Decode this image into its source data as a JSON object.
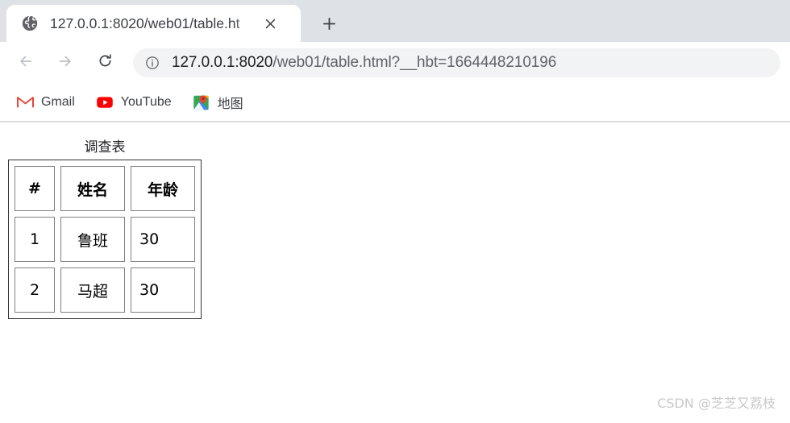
{
  "browser": {
    "tab": {
      "favicon": "globe-icon",
      "title": "127.0.0.1:8020/web01/table.ht",
      "close_label": "✕"
    },
    "new_tab_label": "+",
    "nav": {
      "back_label": "←",
      "forward_label": "→",
      "reload_label": "⟳"
    },
    "omnibox": {
      "info_icon": "info-circle-icon",
      "url_host": "127.0.0.1:8020",
      "url_path": "/web01/table.html?__hbt=1664448210196",
      "url_full": "127.0.0.1:8020/web01/table.html?__hbt=1664448210196"
    },
    "bookmarks": [
      {
        "label": "Gmail",
        "icon": "gmail-icon"
      },
      {
        "label": "YouTube",
        "icon": "youtube-icon"
      },
      {
        "label": "地图",
        "icon": "google-maps-icon"
      }
    ]
  },
  "page": {
    "table": {
      "caption": "调查表",
      "headers": [
        "#",
        "姓名",
        "年龄"
      ],
      "rows": [
        {
          "index": "1",
          "name": "鲁班",
          "age": "30"
        },
        {
          "index": "2",
          "name": "马超",
          "age": "30"
        }
      ]
    },
    "watermark": "CSDN @芝芝又荔枝"
  },
  "colors": {
    "tabstrip_bg": "#dee1e6",
    "omnibox_bg": "#f1f3f4",
    "text_primary": "#202124",
    "text_secondary": "#5f6368",
    "gmail_red": "#ea4335",
    "youtube_red": "#ff0000",
    "watermark_grey": "#c9c9c9"
  }
}
